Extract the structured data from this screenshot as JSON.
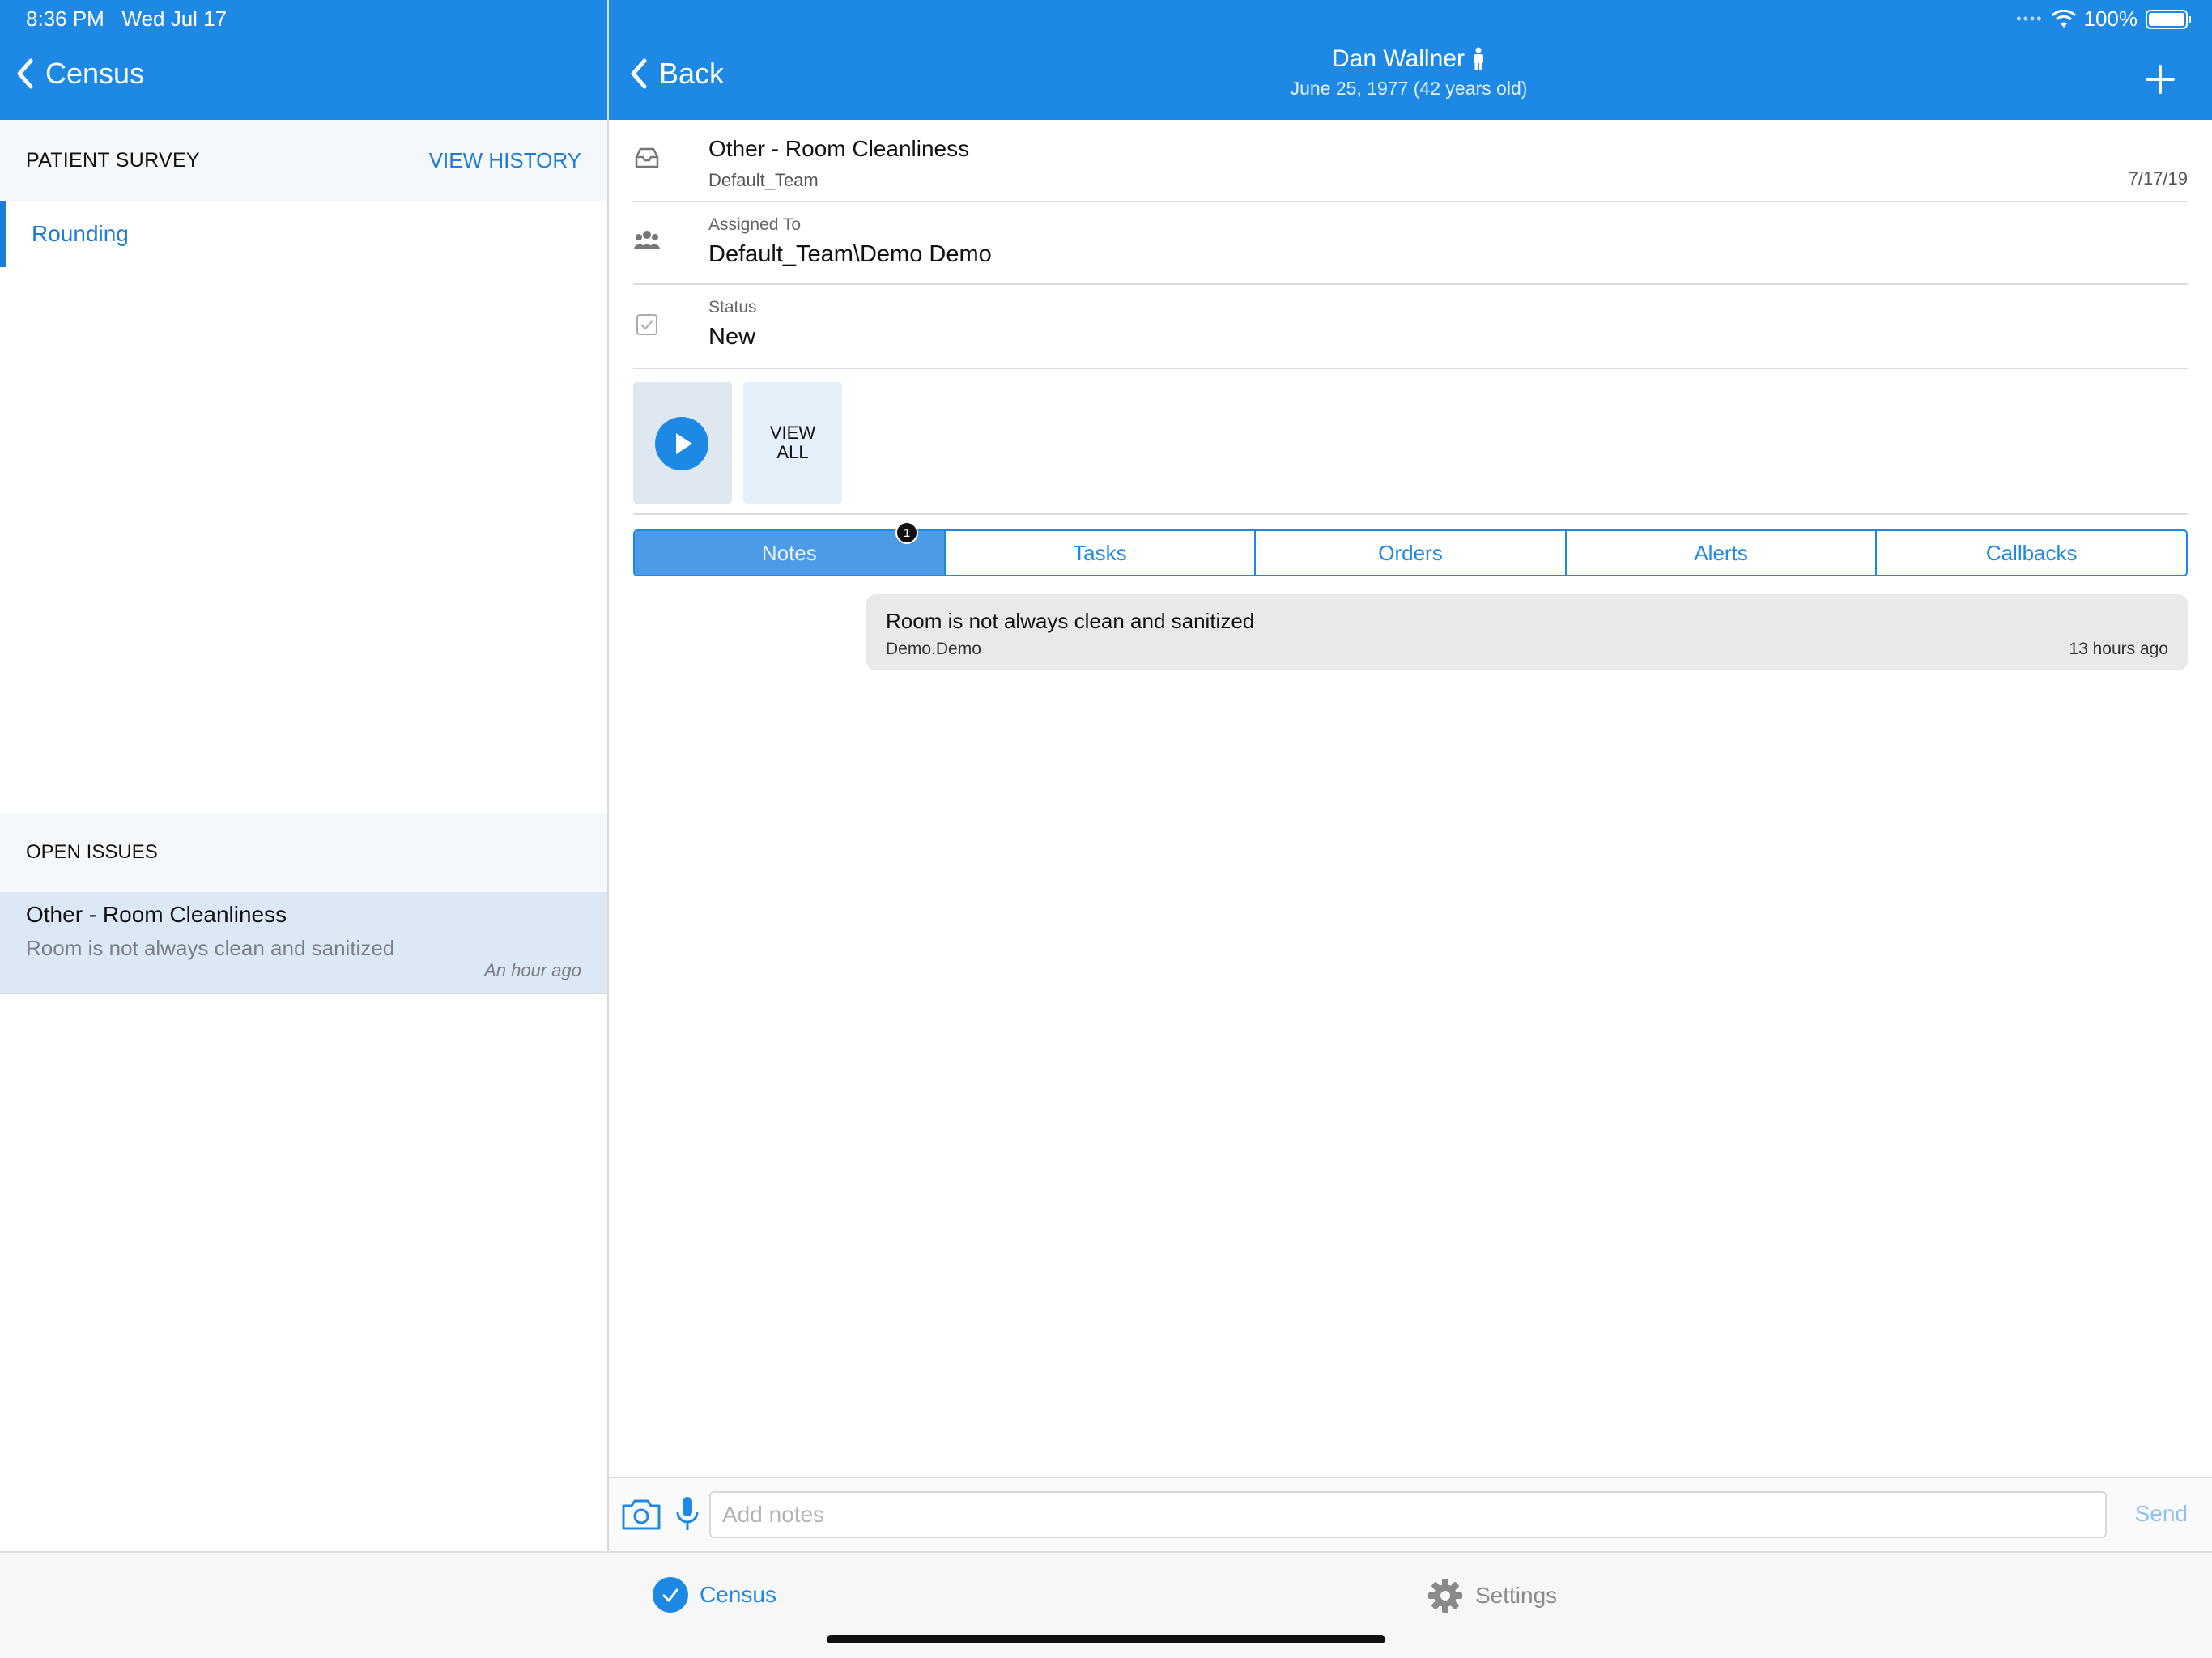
{
  "status_bar": {
    "time": "8:36 PM",
    "date": "Wed Jul 17",
    "battery": "100%"
  },
  "left_header": {
    "back_label": "Census"
  },
  "right_header": {
    "back_label": "Back",
    "patient_name": "Dan Wallner",
    "patient_dob": "June 25, 1977 (42 years old)"
  },
  "survey": {
    "title": "PATIENT SURVEY",
    "history_link": "VIEW HISTORY",
    "items": [
      {
        "label": "Rounding"
      }
    ]
  },
  "open_issues": {
    "title": "OPEN ISSUES",
    "items": [
      {
        "title": "Other - Room Cleanliness",
        "description": "Room is not always clean and sanitized",
        "time": "An hour ago"
      }
    ]
  },
  "detail": {
    "issue_title": "Other - Room Cleanliness",
    "team": "Default_Team",
    "date": "7/17/19",
    "assigned_label": "Assigned To",
    "assigned_value": "Default_Team\\Demo Demo",
    "status_label": "Status",
    "status_value": "New",
    "view_all_line1": "VIEW",
    "view_all_line2": "ALL"
  },
  "tabs": [
    {
      "label": "Notes",
      "active": true,
      "badge": "1"
    },
    {
      "label": "Tasks"
    },
    {
      "label": "Orders"
    },
    {
      "label": "Alerts"
    },
    {
      "label": "Callbacks"
    }
  ],
  "notes": [
    {
      "text": "Room is not always clean and sanitized",
      "author": "Demo.Demo",
      "time": "13 hours ago"
    }
  ],
  "compose": {
    "placeholder": "Add notes",
    "send_label": "Send"
  },
  "tabbar": {
    "census_label": "Census",
    "settings_label": "Settings"
  },
  "colors": {
    "brand": "#1e88e5",
    "link": "#1e7bd6",
    "selected_bg": "#dce8f5"
  }
}
